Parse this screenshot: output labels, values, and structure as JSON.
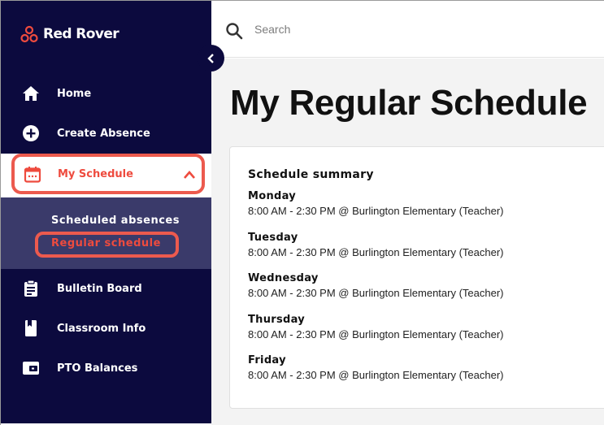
{
  "app": {
    "logo_text": "Red Rover"
  },
  "sidebar": {
    "items": [
      {
        "label": "Home",
        "icon": "home-icon"
      },
      {
        "label": "Create Absence",
        "icon": "plus-circle-icon"
      },
      {
        "label": "My Schedule",
        "icon": "calendar-icon",
        "active": true,
        "expanded": true
      },
      {
        "label": "Bulletin Board",
        "icon": "clipboard-icon"
      },
      {
        "label": "Classroom Info",
        "icon": "bookmark-icon"
      },
      {
        "label": "PTO Balances",
        "icon": "wallet-icon"
      }
    ],
    "sub_items": [
      {
        "label": "Scheduled absences",
        "active": false
      },
      {
        "label": "Regular schedule",
        "active": true
      }
    ]
  },
  "search": {
    "placeholder": "Search"
  },
  "page": {
    "title": "My Regular Schedule"
  },
  "schedule": {
    "summary_title": "Schedule summary",
    "days": [
      {
        "name": "Monday",
        "detail": "8:00 AM - 2:30 PM @ Burlington Elementary (Teacher)"
      },
      {
        "name": "Tuesday",
        "detail": "8:00 AM - 2:30 PM @ Burlington Elementary (Teacher)"
      },
      {
        "name": "Wednesday",
        "detail": "8:00 AM - 2:30 PM @ Burlington Elementary (Teacher)"
      },
      {
        "name": "Thursday",
        "detail": "8:00 AM - 2:30 PM @ Burlington Elementary (Teacher)"
      },
      {
        "name": "Friday",
        "detail": "8:00 AM - 2:30 PM @ Burlington Elementary (Teacher)"
      }
    ]
  },
  "colors": {
    "sidebar_bg": "#0c0a3e",
    "accent": "#ee4b3e",
    "highlight_outline": "#ec5a4e",
    "subnav_bg": "#3a3a6a",
    "sub_item_active": "#ee4b3e",
    "sub_item_inactive": "#ffffff",
    "main_bg": "#f3f3f3"
  }
}
